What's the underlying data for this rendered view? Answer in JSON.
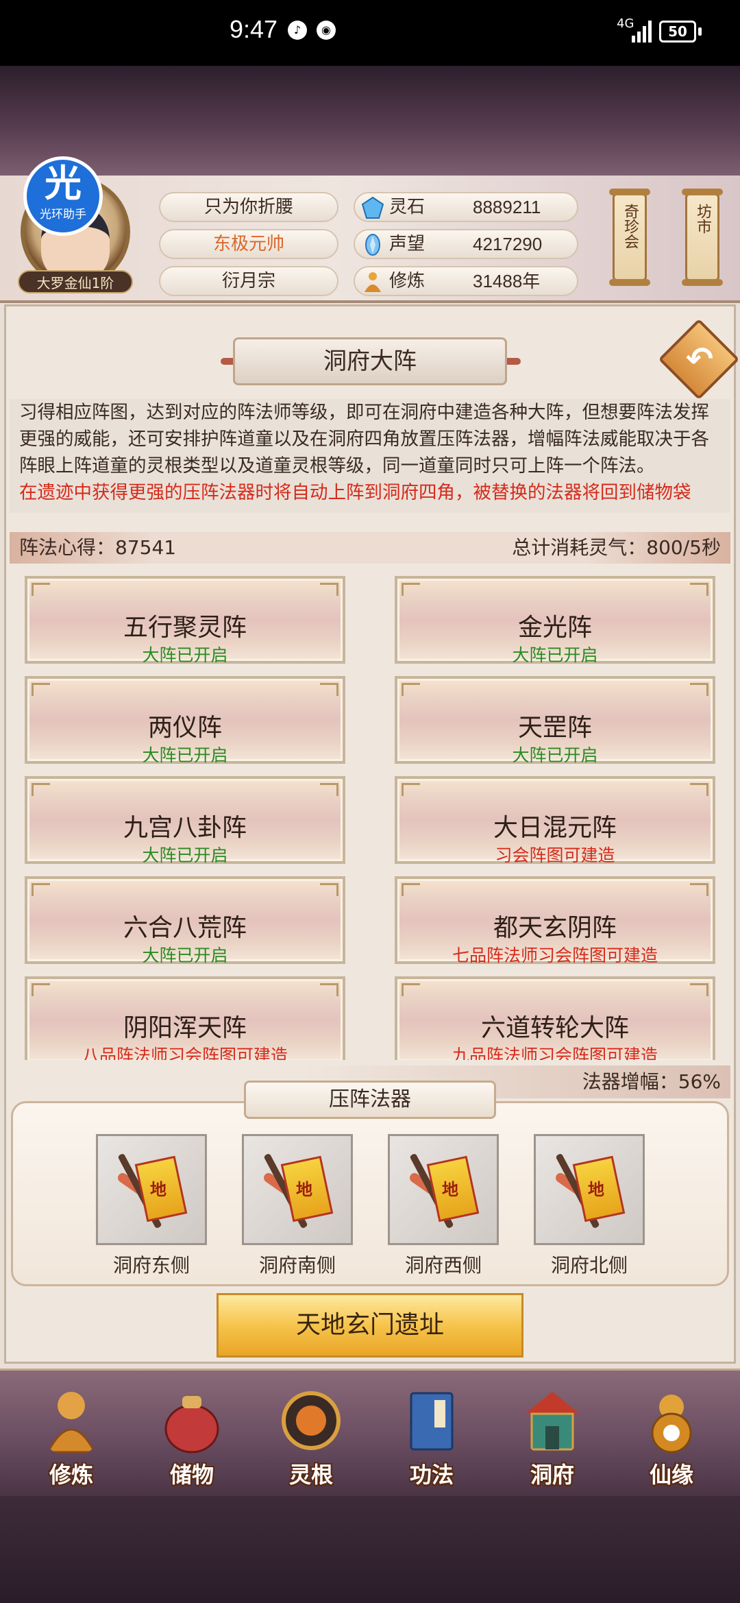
{
  "status_bar": {
    "time": "9:47",
    "network": "4G",
    "battery": "50"
  },
  "player": {
    "badge_big": "光",
    "badge_small": "光环助手",
    "rank": "大罗金仙1阶",
    "name": "只为你折腰",
    "title": "东极元帅",
    "sect": "衍月宗"
  },
  "resources": [
    {
      "label": "灵石",
      "value": "8889211",
      "icon": "spirit-stone-icon"
    },
    {
      "label": "声望",
      "value": "4217290",
      "icon": "reputation-icon"
    },
    {
      "label": "修炼",
      "value": "31488年",
      "icon": "cultivation-icon"
    }
  ],
  "side_buttons": [
    {
      "label": "奇珍会"
    },
    {
      "label": "坊市"
    }
  ],
  "page": {
    "title": "洞府大阵",
    "description": "习得相应阵图，达到对应的阵法师等级，即可在洞府中建造各种大阵，但想要阵法发挥更强的威能，还可安排护阵道童以及在洞府四角放置压阵法器，增幅阵法威能取决于各阵眼上阵道童的灵根类型以及道童灵根等级，同一道童同时只可上阵一个阵法。",
    "warning": "在遗迹中获得更强的压阵法器时将自动上阵到洞府四角，被替换的法器将回到储物袋",
    "insight": "阵法心得：87541",
    "consumption": "总计消耗灵气：800/5秒"
  },
  "arrays": [
    {
      "name": "五行聚灵阵",
      "status": "大阵已开启",
      "color": "green"
    },
    {
      "name": "金光阵",
      "status": "大阵已开启",
      "color": "green"
    },
    {
      "name": "两仪阵",
      "status": "大阵已开启",
      "color": "green"
    },
    {
      "name": "天罡阵",
      "status": "大阵已开启",
      "color": "green"
    },
    {
      "name": "九宫八卦阵",
      "status": "大阵已开启",
      "color": "green"
    },
    {
      "name": "大日混元阵",
      "status": "习会阵图可建造",
      "color": "red"
    },
    {
      "name": "六合八荒阵",
      "status": "大阵已开启",
      "color": "green"
    },
    {
      "name": "都天玄阴阵",
      "status": "七品阵法师习会阵图可建造",
      "color": "red"
    },
    {
      "name": "阴阳浑天阵",
      "status": "八品阵法师习会阵图可建造",
      "color": "red"
    },
    {
      "name": "六道转轮大阵",
      "status": "九品阵法师习会阵图可建造",
      "color": "red"
    }
  ],
  "artifacts": {
    "bonus": "法器增幅：56%",
    "title": "压阵法器",
    "flag_char": "地",
    "slots": [
      {
        "label": "洞府东侧"
      },
      {
        "label": "洞府南侧"
      },
      {
        "label": "洞府西侧"
      },
      {
        "label": "洞府北侧"
      }
    ]
  },
  "ruins_button": "天地玄门遗址",
  "nav": [
    {
      "label": "修炼",
      "icon": "cultivate-monk-icon"
    },
    {
      "label": "储物",
      "icon": "storage-bag-icon"
    },
    {
      "label": "灵根",
      "icon": "spirit-root-icon"
    },
    {
      "label": "功法",
      "icon": "technique-book-icon"
    },
    {
      "label": "洞府",
      "icon": "cave-mansion-icon"
    },
    {
      "label": "仙缘",
      "icon": "gourd-icon"
    }
  ],
  "colors": {
    "green_status": "#2a8a22",
    "red_status": "#d52a1a",
    "title_orange": "#d9682a",
    "button_gold": "#f6c44c"
  }
}
